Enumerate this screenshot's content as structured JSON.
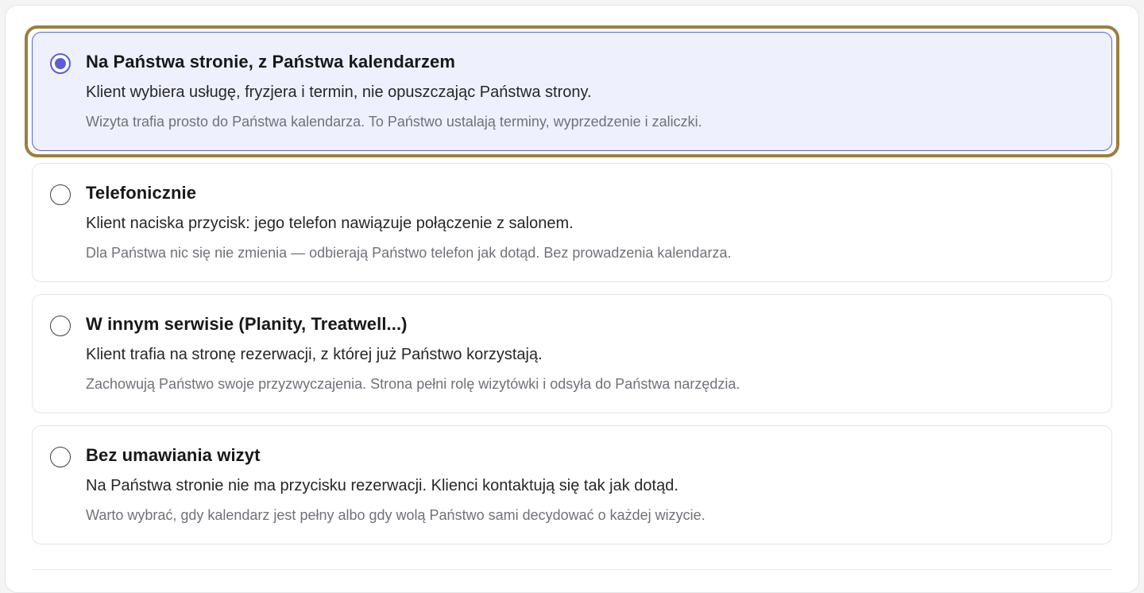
{
  "options": [
    {
      "title": "Na Państwa stronie, z Państwa kalendarzem",
      "description": "Klient wybiera usługę, fryzjera i termin, nie opuszczając Państwa strony.",
      "note": "Wizyta trafia prosto do Państwa kalendarza. To Państwo ustalają terminy, wyprzedzenie i zaliczki.",
      "selected": true
    },
    {
      "title": "Telefonicznie",
      "description": "Klient naciska przycisk: jego telefon nawiązuje połączenie z salonem.",
      "note": "Dla Państwa nic się nie zmienia — odbierają Państwo telefon jak dotąd. Bez prowadzenia kalendarza.",
      "selected": false
    },
    {
      "title": "W innym serwisie (Planity, Treatwell...)",
      "description": "Klient trafia na stronę rezerwacji, z której już Państwo korzystają.",
      "note": "Zachowują Państwo swoje przyzwyczajenia. Strona pełni rolę wizytówki i odsyła do Państwa narzędzia.",
      "selected": false
    },
    {
      "title": "Bez umawiania wizyt",
      "description": "Na Państwa stronie nie ma przycisku rezerwacji. Klienci kontaktują się tak jak dotąd.",
      "note": "Warto wybrać, gdy kalendarz jest pełny albo gdy wolą Państwo sami decydować o każdej wizycie.",
      "selected": false
    }
  ],
  "colors": {
    "accent": "#5b5fd6",
    "selected_background": "#eef0fd",
    "focus_ring": "#9b7f3f",
    "border": "#e4e4e7",
    "title_text": "#18181b",
    "description_text": "#27272a",
    "note_text": "#71717a"
  }
}
